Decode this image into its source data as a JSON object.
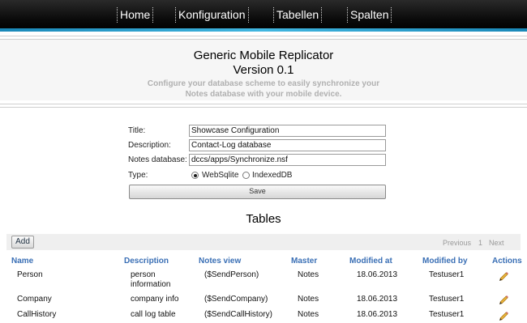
{
  "nav": {
    "items": [
      {
        "label": "Home"
      },
      {
        "label": "Konfiguration"
      },
      {
        "label": "Tabellen"
      },
      {
        "label": "Spalten"
      }
    ]
  },
  "header": {
    "title": "Generic Mobile Replicator",
    "version": "Version 0.1",
    "subtitle_line1": "Configure your database scheme to easily synchronize your",
    "subtitle_line2": "Notes database with your mobile device."
  },
  "form": {
    "title_label": "Title:",
    "title_value": "Showcase Configuration",
    "description_label": "Description:",
    "description_value": "Contact-Log database",
    "notes_db_label": "Notes database:",
    "notes_db_value": "dccs/apps/Synchronize.nsf",
    "type_label": "Type:",
    "type_options": [
      "WebSqlite",
      "IndexedDB"
    ],
    "type_selected": "WebSqlite",
    "save_label": "Save"
  },
  "tables": {
    "title": "Tables",
    "add_label": "Add",
    "pager": {
      "previous": "Previous",
      "page": "1",
      "next": "Next"
    },
    "columns": [
      "Name",
      "Description",
      "Notes view",
      "Master",
      "Modified at",
      "Modified by",
      "Actions"
    ],
    "rows": [
      {
        "name": "Person",
        "description_line1": "person",
        "description_line2": "information",
        "notes_view": "($SendPerson)",
        "master": "Notes",
        "modified_at": "18.06.2013",
        "modified_by": "Testuser1"
      },
      {
        "name": "Company",
        "description_line1": "company info",
        "description_line2": "",
        "notes_view": "($SendCompany)",
        "master": "Notes",
        "modified_at": "18.06.2013",
        "modified_by": "Testuser1"
      },
      {
        "name": "CallHistory",
        "description_line1": "call log table",
        "description_line2": "",
        "notes_view": "($SendCallHistory)",
        "master": "Notes",
        "modified_at": "18.06.2013",
        "modified_by": "Testuser1"
      }
    ]
  },
  "icons": {
    "edit": "pencil-icon"
  },
  "colors": {
    "nav_background": "#0b0b0b",
    "nav_accent": "#41b6e0",
    "header_link": "#3a6fb5",
    "subtitle": "#b0b0b0"
  }
}
